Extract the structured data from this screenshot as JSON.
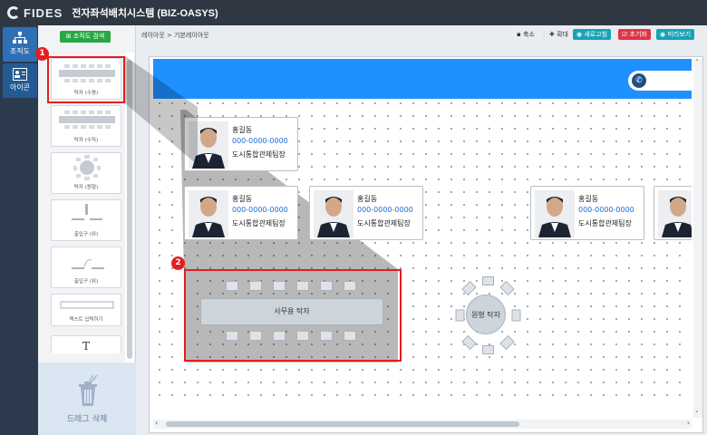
{
  "app": {
    "logo": "FIDES",
    "title": "전자좌석배치시스템 (BIZ-OASYS)"
  },
  "rail": [
    {
      "label": "조직도"
    },
    {
      "label": "아이콘"
    }
  ],
  "palette": {
    "search_label": "조직도 검색",
    "items": [
      {
        "label": "탁자 (수평)"
      },
      {
        "label": "탁자 (수직)"
      },
      {
        "label": "탁자 (원형)"
      },
      {
        "label": "출입구 (위)"
      },
      {
        "label": "출입구 (위)"
      },
      {
        "label": "텍스트 입력하기"
      },
      {
        "label": "T"
      }
    ],
    "trash_label": "드래그 삭제"
  },
  "breadcrumb": "레이아웃 > 기본레이아웃",
  "toolbar": {
    "shrink": "축소",
    "expand": "확대",
    "refresh": "새로고침",
    "reset": "초기화",
    "preview": "미리보기"
  },
  "cards": [
    {
      "name": "홍길동",
      "phone": "000-0000-0000",
      "dept": "도시통합관제팀장"
    },
    {
      "name": "홍길동",
      "phone": "000-0000-0000",
      "dept": "도시통합관제팀장"
    },
    {
      "name": "홍길동",
      "phone": "000-0000-0000",
      "dept": "도시통합관제팀장"
    },
    {
      "name": "홍길동",
      "phone": "000-0000-0000",
      "dept": "도시통합관제팀장"
    },
    {
      "name": "",
      "phone": "",
      "dept": ""
    }
  ],
  "tables": {
    "office": "사무용 탁자",
    "round": "원형 탁자"
  },
  "annotations": {
    "badge1": "1",
    "badge2": "2"
  },
  "colors": {
    "accent_blue": "#1e90ff",
    "badge_red": "#e41e1e",
    "search_green": "#28a745",
    "refresh_teal": "#17a2b8",
    "reset_red": "#dc3545"
  }
}
